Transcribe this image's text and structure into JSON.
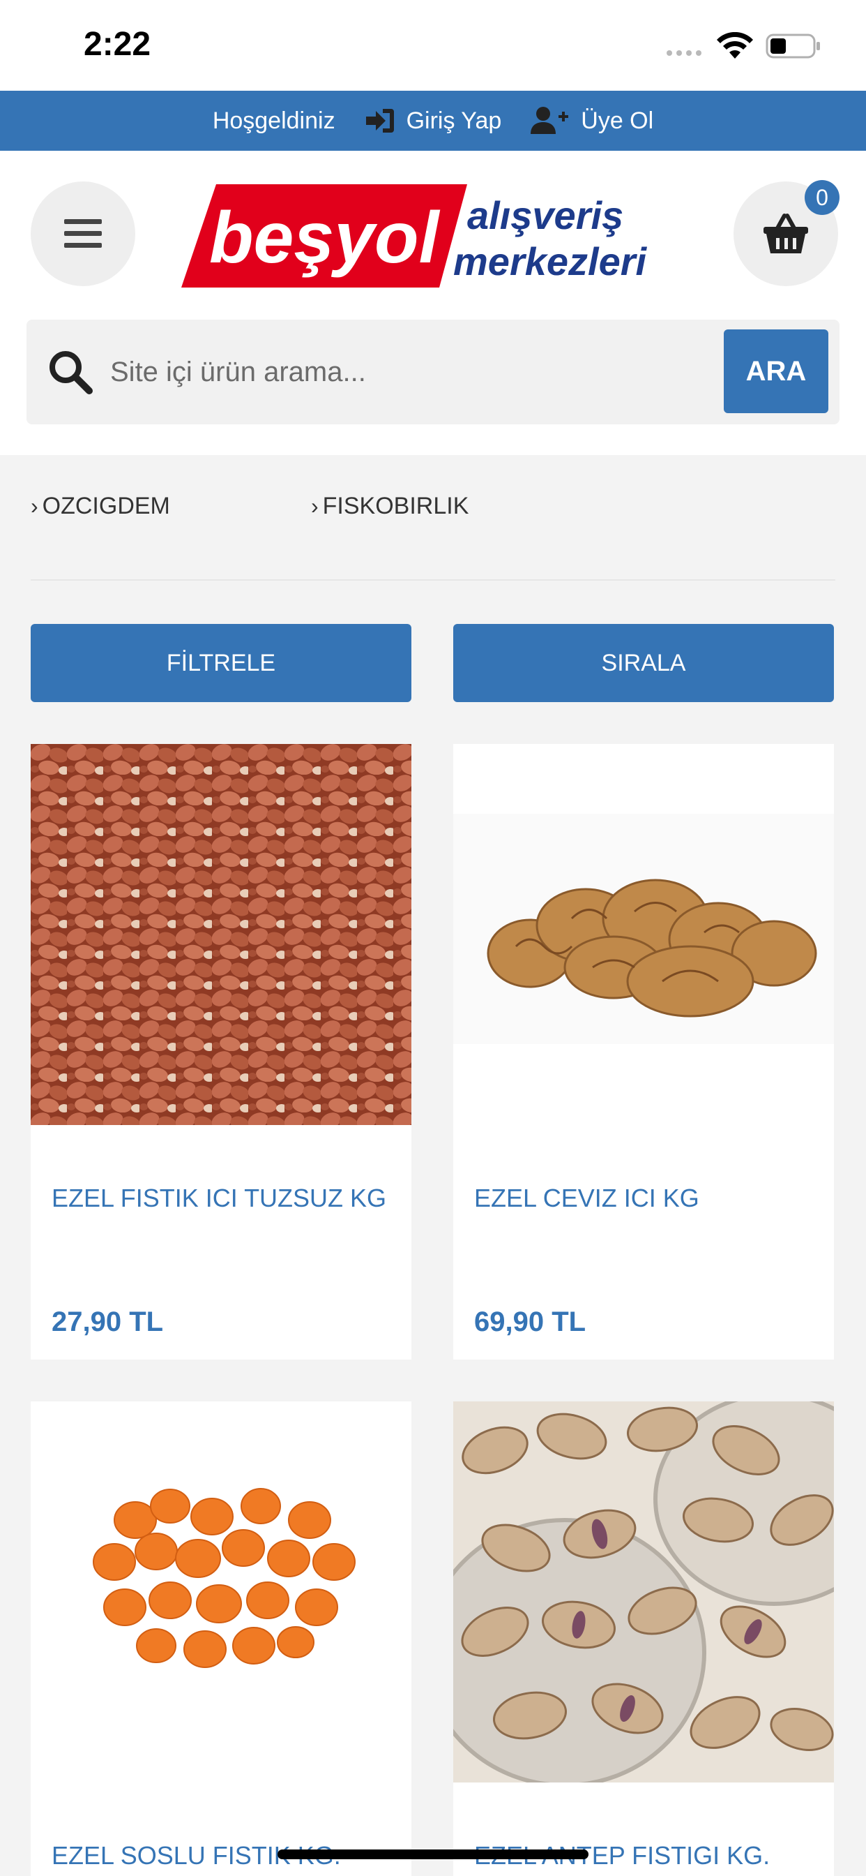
{
  "status_bar": {
    "time": "2:22"
  },
  "top_bar": {
    "welcome": "Hoşgeldiniz",
    "login": "Giriş Yap",
    "register": "Üye Ol"
  },
  "header": {
    "logo_text_main": "beşyol",
    "logo_text_line1": "alışveriş",
    "logo_text_line2": "merkezleri",
    "cart_count": "0"
  },
  "search": {
    "placeholder": "Site içi ürün arama...",
    "button_label": "ARA"
  },
  "brands": [
    {
      "label": "OZCIGDEM"
    },
    {
      "label": "FISKOBIRLIK"
    }
  ],
  "actions": {
    "filter_label": "FİLTRELE",
    "sort_label": "SIRALA"
  },
  "products": [
    {
      "title": "EZEL FISTIK ICI TUZSUZ KG",
      "price": "27,90 TL",
      "image": "peanuts-image"
    },
    {
      "title": "EZEL CEVIZ ICI KG",
      "price": "69,90 TL",
      "image": "walnuts-image"
    },
    {
      "title": "EZEL SOSLU FISTIK KG.",
      "price": "",
      "image": "coated-peanuts-image"
    },
    {
      "title": "EZEL ANTEP FISTIGI KG.",
      "price": "",
      "image": "pistachios-image"
    }
  ],
  "colors": {
    "brand_blue": "#3574b5",
    "logo_red": "#e1001b",
    "logo_navy": "#1d3b8b"
  }
}
